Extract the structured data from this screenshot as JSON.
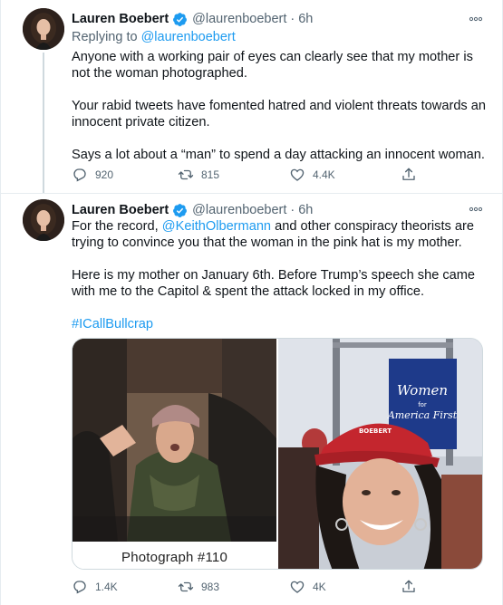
{
  "tweets": [
    {
      "author_name": "Lauren Boebert",
      "handle": "@laurenboebert",
      "separator": "·",
      "time": "6h",
      "replying_prefix": "Replying to",
      "replying_to": "@laurenboebert",
      "lines": {
        "l1": "Anyone with a working pair of eyes can clearly see that my mother is",
        "l2": "not the woman photographed.",
        "l3": "Your rabid tweets have fomented hatred and violent threats towards an",
        "l4": "innocent private citizen.",
        "l5": "Says a lot about a “man” to spend a day attacking an innocent woman."
      },
      "replies": "920",
      "retweets": "815",
      "likes": "4.4K"
    },
    {
      "author_name": "Lauren Boebert",
      "handle": "@laurenboebert",
      "separator": "·",
      "time": "6h",
      "lines": {
        "l1_prefix": "For the record,",
        "l1_mention": "@KeithOlbermann",
        "l1_suffix": "and other conspiracy theorists are",
        "l2": "trying to convince you that the woman in the pink hat is my mother.",
        "l3": "Here is my mother on January 6th. Before Trump’s speech she came",
        "l4": "with me to the Capitol & spent the attack locked in my office.",
        "hashtag": "#ICallBullcrap"
      },
      "media": {
        "caption": "Photograph #110",
        "banner_line1": "Women",
        "banner_line2": "for",
        "banner_line3": "America First",
        "hat_text": "BOEBERT"
      },
      "replies": "1.4K",
      "retweets": "983",
      "likes": "4K"
    }
  ],
  "icons": {
    "more": "more-icon",
    "reply": "reply-icon",
    "retweet": "retweet-icon",
    "like": "like-icon",
    "share": "share-icon",
    "verified": "verified-badge-icon"
  },
  "colors": {
    "link": "#1d9bf0",
    "secondary_text": "#536471",
    "primary_text": "#0f1419",
    "thread_line": "#cfd9de"
  }
}
